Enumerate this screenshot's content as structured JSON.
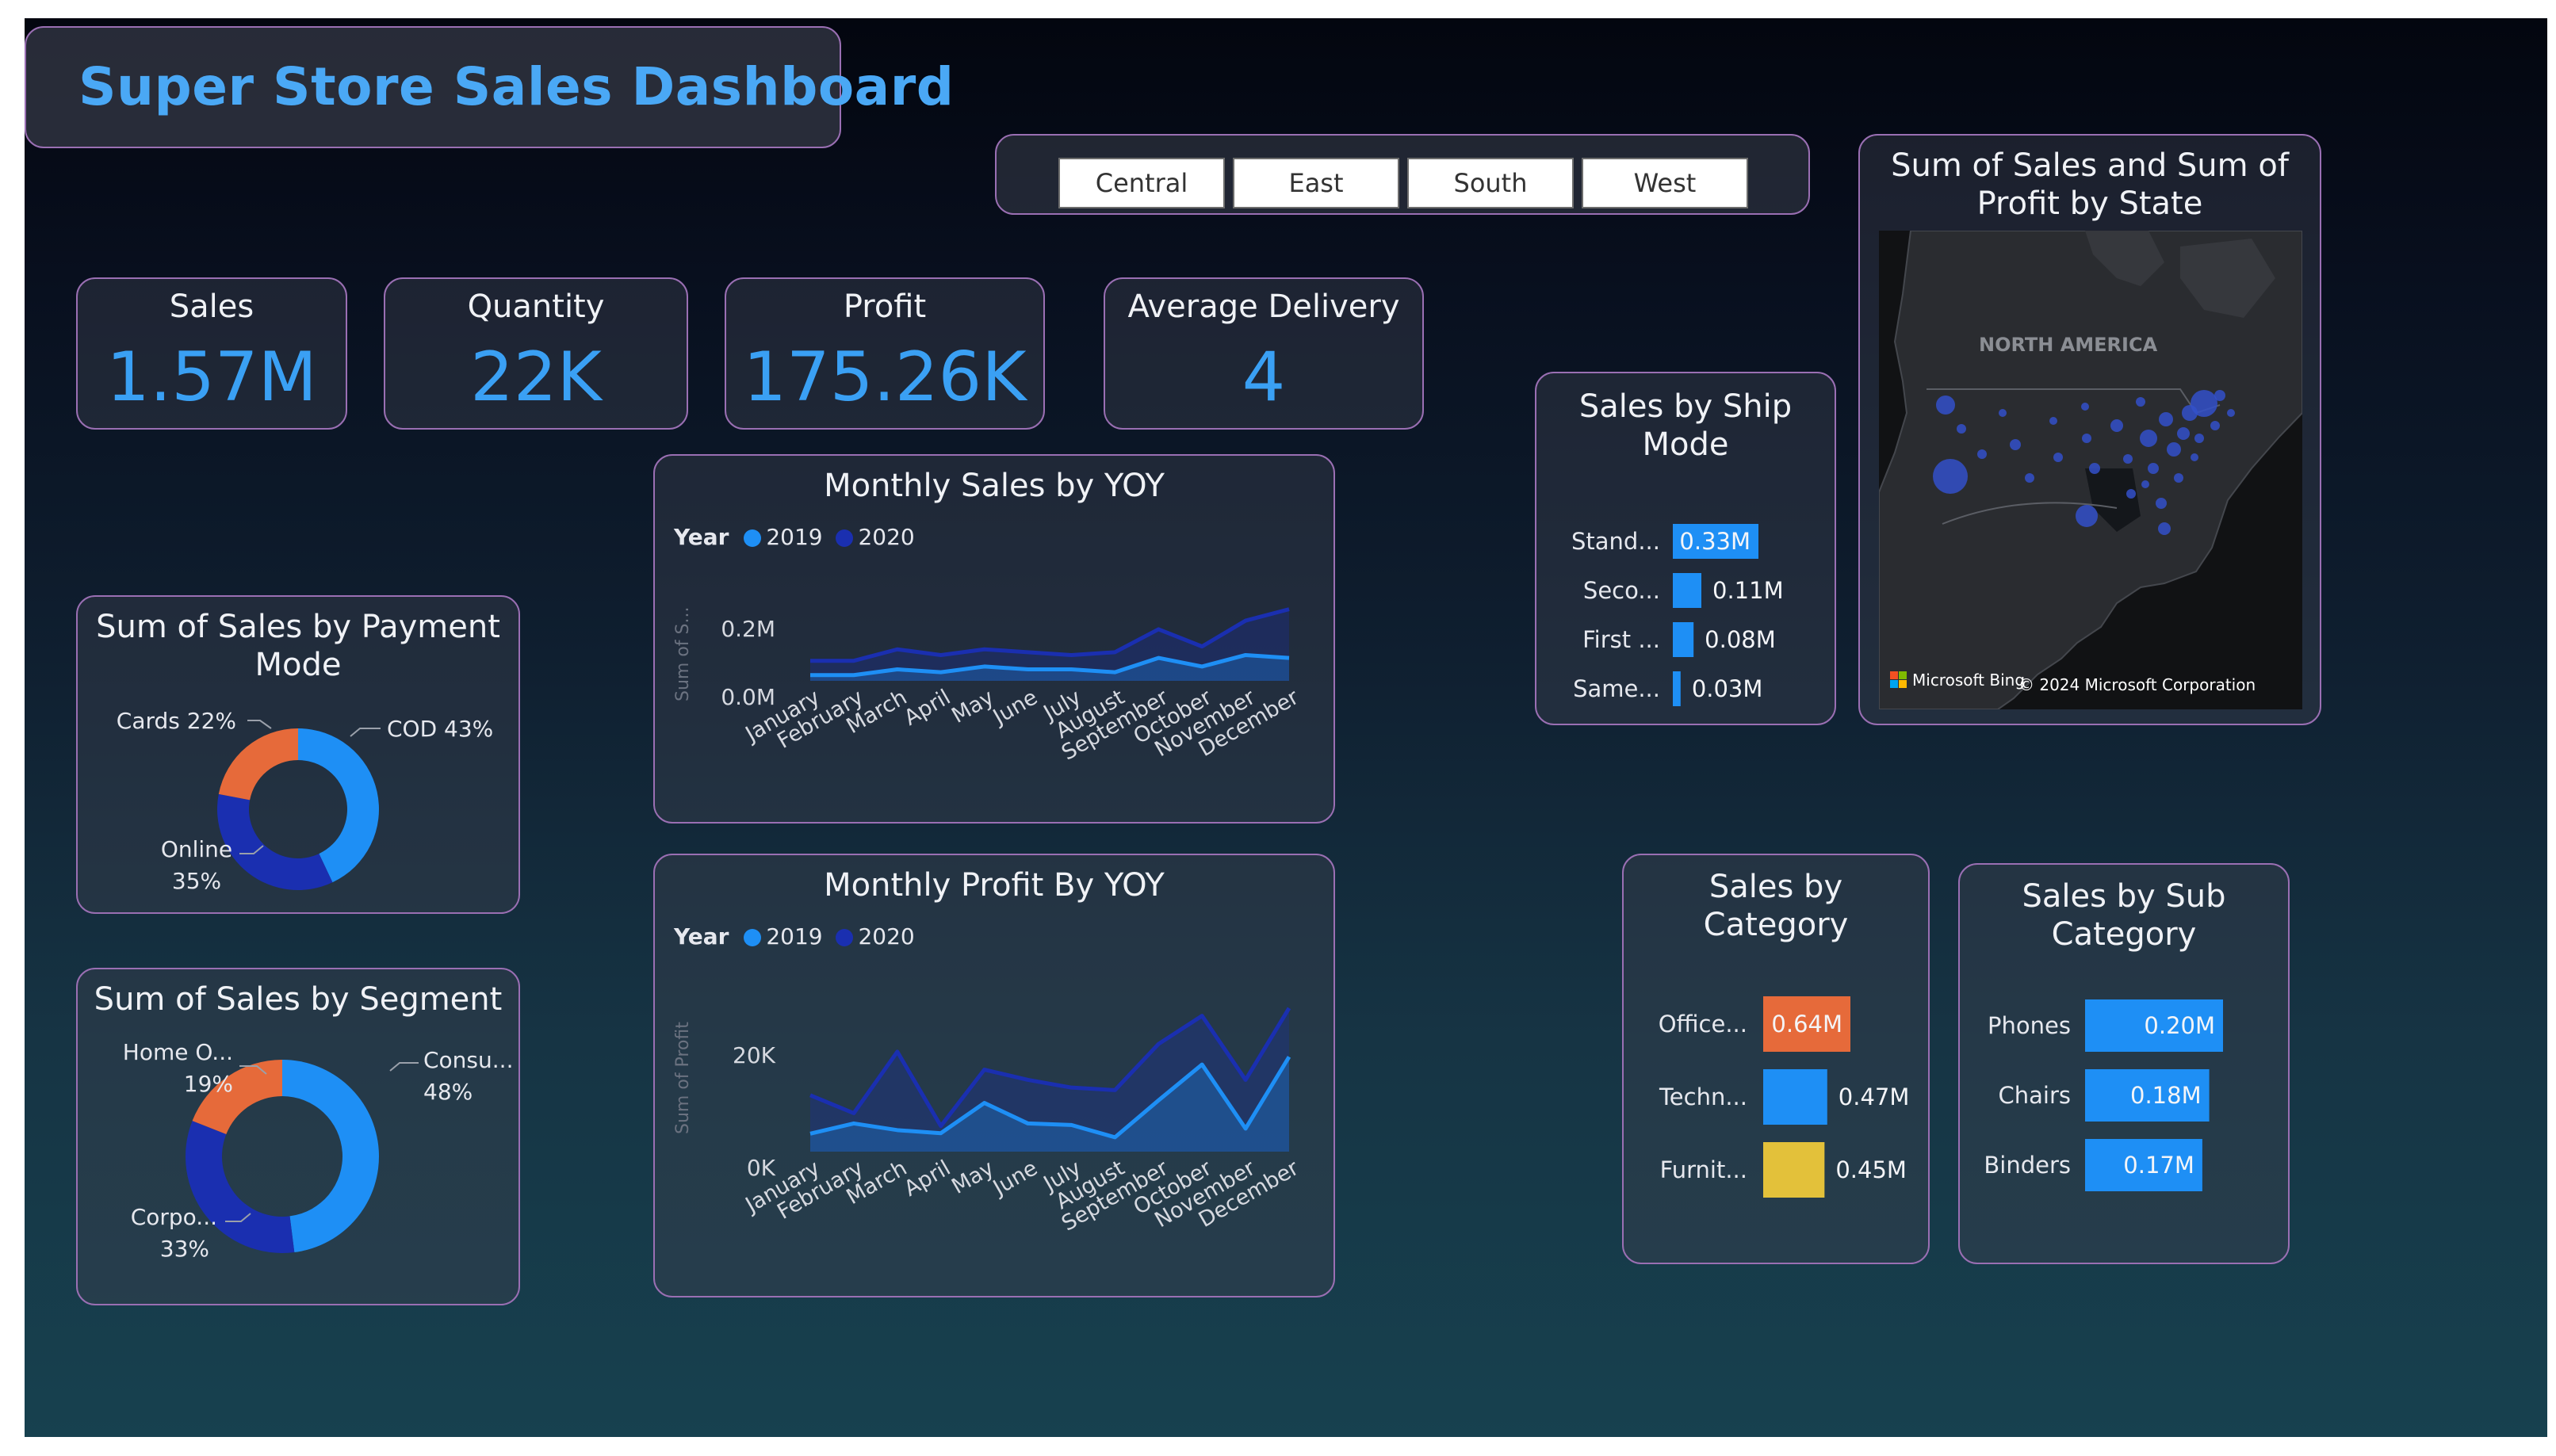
{
  "header": {
    "title": "Super Store Sales Dashboard"
  },
  "slicer": {
    "regions": [
      "Central",
      "East",
      "South",
      "West"
    ]
  },
  "kpis": {
    "sales": {
      "label": "Sales",
      "value": "1.57M"
    },
    "quantity": {
      "label": "Quantity",
      "value": "22K"
    },
    "profit": {
      "label": "Profit",
      "value": "175.26K"
    },
    "delivery": {
      "label": "Average Delivery",
      "value": "4"
    }
  },
  "colors": {
    "blue": "#1e8ff5",
    "navy": "#1a2fb0",
    "orange": "#e66a3a",
    "yellow": "#e3c13a",
    "border": "#9a6fb3",
    "title": "#4aa8f5"
  },
  "payment_chart": {
    "title": "Sum of Sales by Payment Mode",
    "labels": {
      "cod": "COD 43%",
      "cards": "Cards 22%",
      "online_name": "Online",
      "online_pct": "35%"
    },
    "chart_data": {
      "type": "pie",
      "labels": [
        "COD",
        "Online",
        "Cards"
      ],
      "values": [
        43,
        35,
        22
      ],
      "colors": [
        "#1e8ff5",
        "#1a2fb0",
        "#e66a3a"
      ]
    }
  },
  "segment_chart": {
    "title": "Sum of Sales by Segment",
    "labels": {
      "consumer_name": "Consu...",
      "consumer_pct": "48%",
      "corporate_name": "Corpo...",
      "corporate_pct": "33%",
      "home_name": "Home O...",
      "home_pct": "19%"
    },
    "chart_data": {
      "type": "pie",
      "labels": [
        "Consu...",
        "Corpo...",
        "Home O..."
      ],
      "values": [
        48,
        33,
        19
      ],
      "colors": [
        "#1e8ff5",
        "#1a2fb0",
        "#e66a3a"
      ]
    }
  },
  "monthly_sales": {
    "title": "Monthly Sales by YOY",
    "legend_title": "Year",
    "ylabel": "Sum of S...",
    "yticks": [
      "0.2M",
      "0.0M"
    ],
    "chart_data": {
      "type": "area",
      "categories": [
        "January",
        "February",
        "March",
        "April",
        "May",
        "June",
        "July",
        "August",
        "September",
        "October",
        "November",
        "December"
      ],
      "series": [
        {
          "name": "2019",
          "values": [
            0.02,
            0.02,
            0.04,
            0.03,
            0.05,
            0.04,
            0.04,
            0.03,
            0.08,
            0.05,
            0.09,
            0.08
          ],
          "color": "#1e8ff5"
        },
        {
          "name": "2020",
          "values": [
            0.07,
            0.07,
            0.11,
            0.09,
            0.11,
            0.1,
            0.09,
            0.1,
            0.18,
            0.12,
            0.21,
            0.25
          ],
          "color": "#1a2fb0"
        }
      ],
      "ylim": [
        0,
        0.26
      ]
    }
  },
  "monthly_profit": {
    "title": "Monthly Profit By YOY",
    "legend_title": "Year",
    "ylabel": "Sum of Profit",
    "yticks": [
      "20K",
      "0K"
    ],
    "chart_data": {
      "type": "area",
      "categories": [
        "January",
        "February",
        "March",
        "April",
        "May",
        "June",
        "July",
        "August",
        "September",
        "October",
        "November",
        "December"
      ],
      "series": [
        {
          "name": "2019",
          "values": [
            3500,
            5500,
            4200,
            3600,
            9500,
            5500,
            5200,
            2800,
            10000,
            17000,
            4500,
            18500
          ],
          "color": "#1e8ff5"
        },
        {
          "name": "2020",
          "values": [
            11000,
            7500,
            19500,
            5000,
            16000,
            14000,
            12500,
            12000,
            21000,
            26500,
            14000,
            28000
          ],
          "color": "#1a2fb0"
        }
      ],
      "ylim": [
        0,
        30000
      ]
    }
  },
  "ship_mode": {
    "title": "Sales by Ship Mode",
    "chart_data": {
      "type": "bar",
      "categories": [
        "Stand...",
        "Seco...",
        "First ...",
        "Same..."
      ],
      "values": [
        0.33,
        0.11,
        0.08,
        0.03
      ],
      "labels": [
        "0.33M",
        "0.11M",
        "0.08M",
        "0.03M"
      ],
      "color": "#1e8ff5"
    }
  },
  "map": {
    "title": "Sum of Sales and Sum of Profit by State",
    "region_label": "NORTH AMERICA",
    "attribution_brand": "Microsoft Bing",
    "copyright": "© 2024 Microsoft Corporation"
  },
  "category": {
    "title": "Sales by Category",
    "chart_data": {
      "type": "bar",
      "categories": [
        "Office...",
        "Techn...",
        "Furnit..."
      ],
      "values": [
        0.64,
        0.47,
        0.45
      ],
      "labels": [
        "0.64M",
        "0.47M",
        "0.45M"
      ],
      "colors": [
        "#e66a3a",
        "#1e8ff5",
        "#e3c13a"
      ]
    }
  },
  "sub_category": {
    "title": "Sales by Sub Category",
    "chart_data": {
      "type": "bar",
      "categories": [
        "Phones",
        "Chairs",
        "Binders"
      ],
      "values": [
        0.2,
        0.18,
        0.17
      ],
      "labels": [
        "0.20M",
        "0.18M",
        "0.17M"
      ],
      "color": "#1e8ff5"
    }
  }
}
